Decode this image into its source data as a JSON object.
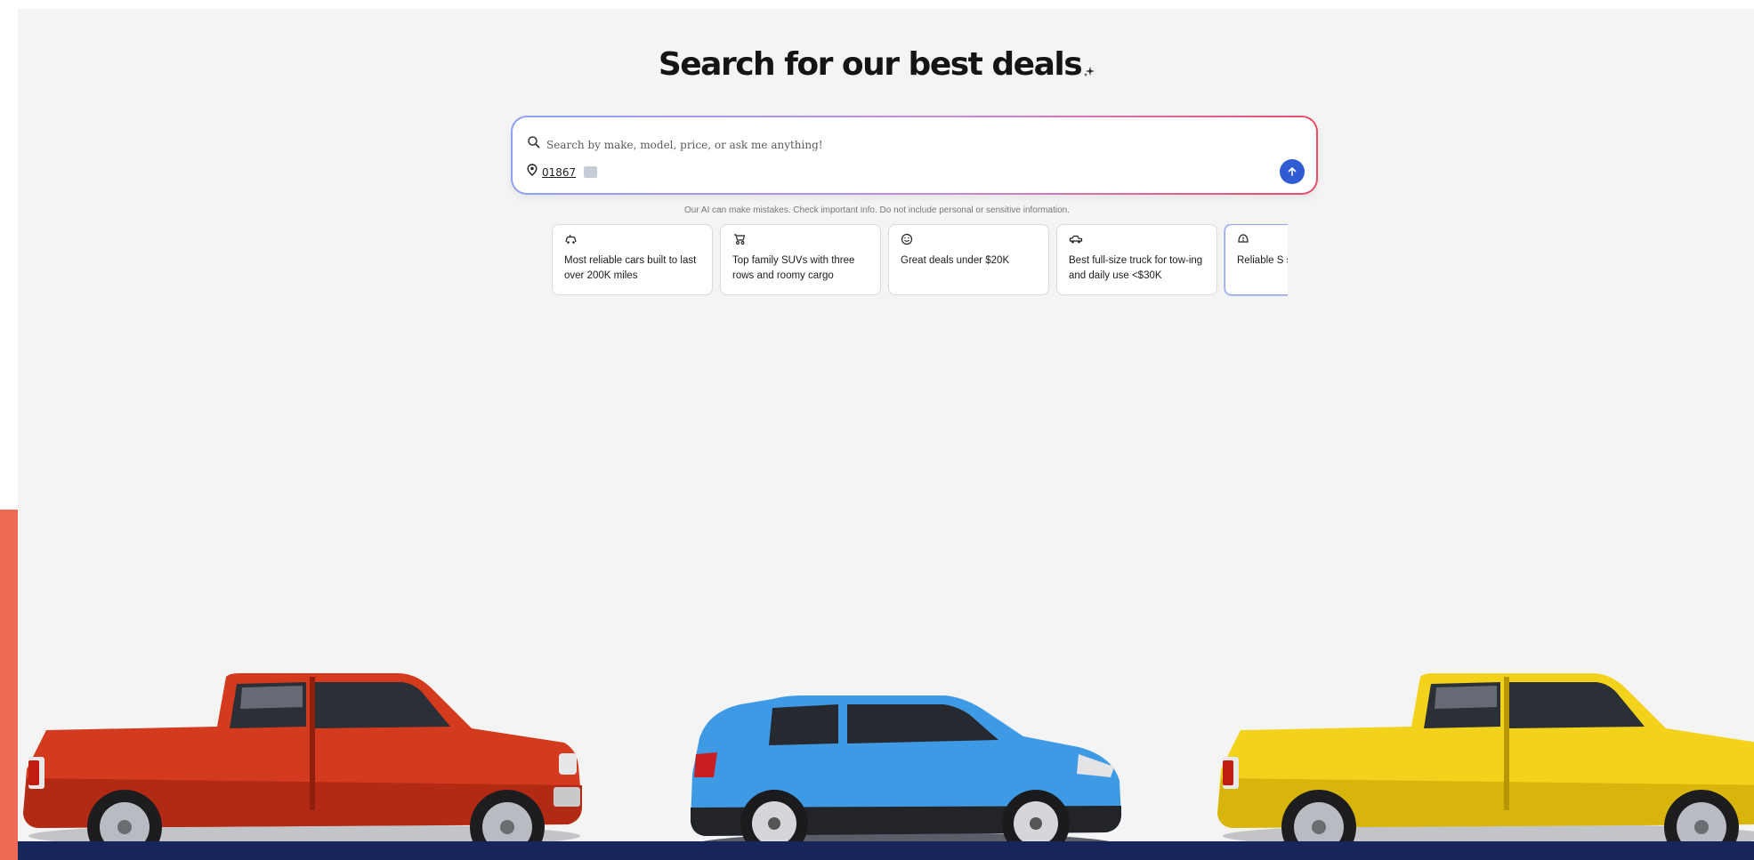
{
  "hero": {
    "title": "Search for our best deals",
    "sparkle_icon": "sparkle-icon"
  },
  "search": {
    "placeholder": "Search by make, model, price, or ask me anything!",
    "search_icon": "magnifier-icon",
    "location_icon": "map-pin-icon",
    "zip": "01867",
    "submit_icon": "arrow-up-icon"
  },
  "disclaimer": "Our AI can make mistakes. Check important info. Do not include personal or sensitive information.",
  "suggestions": [
    {
      "icon": "car-rating-icon",
      "text": "Most reliable cars built to last over 200K miles"
    },
    {
      "icon": "stroller-icon",
      "text": "Top family SUVs with three rows and roomy cargo"
    },
    {
      "icon": "smile-icon",
      "text": "Great deals under $20K"
    },
    {
      "icon": "truck-icon",
      "text": "Best full-size truck for tow-ing and daily use <$30K"
    },
    {
      "icon": "shield-alert-icon",
      "text": "Reliable S safety rati"
    }
  ],
  "vehicles": [
    {
      "name": "red-pickup-truck",
      "color": "#d43a1e"
    },
    {
      "name": "blue-compact-suv",
      "color": "#3f9ae6"
    },
    {
      "name": "yellow-pickup-truck",
      "color": "#f2d21b"
    }
  ],
  "colors": {
    "accent": "#2f5bd3",
    "brand_orange": "#ee6a55",
    "road_navy": "#16265b",
    "page_bg": "#f4f4f5"
  }
}
